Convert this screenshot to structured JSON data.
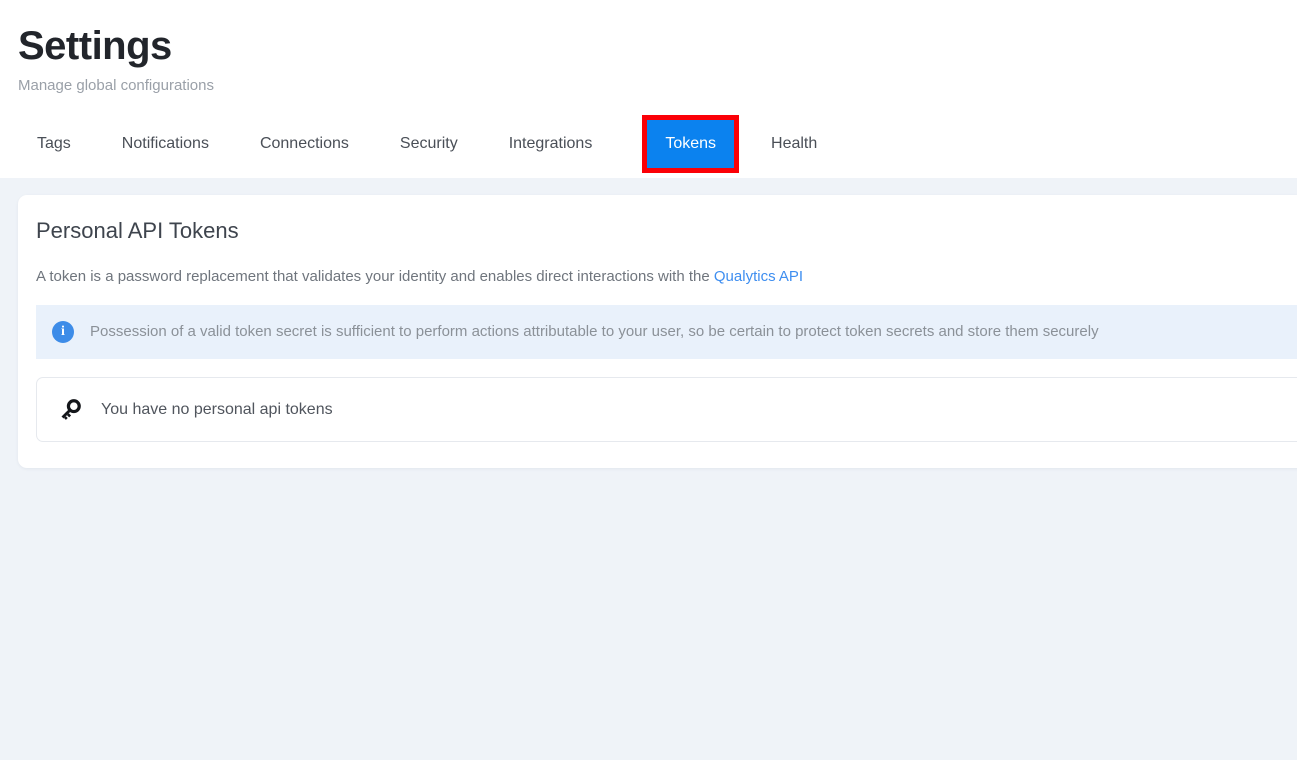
{
  "header": {
    "title": "Settings",
    "subtitle": "Manage global configurations"
  },
  "tabs": [
    {
      "label": "Tags",
      "active": false
    },
    {
      "label": "Notifications",
      "active": false
    },
    {
      "label": "Connections",
      "active": false
    },
    {
      "label": "Security",
      "active": false
    },
    {
      "label": "Integrations",
      "active": false
    },
    {
      "label": "Tokens",
      "active": true
    },
    {
      "label": "Health",
      "active": false
    }
  ],
  "card": {
    "title": "Personal API Tokens",
    "description_prefix": "A token is a password replacement that validates your identity and enables direct interactions with the ",
    "description_link": "Qualytics API",
    "info_icon": "info-circle-icon",
    "info_text": "Possession of a valid token secret is sufficient to perform actions attributable to your user, so be certain to protect token secrets and store them securely",
    "empty_icon": "key-icon",
    "empty_text": "You have no personal api tokens"
  },
  "colors": {
    "accent_blue": "#0b82ef",
    "highlight_red": "#fb0007",
    "link_blue": "#3e8ef0",
    "info_bg": "#e9f1fb",
    "info_icon_blue": "#3d8ce8",
    "page_bg": "#eff3f8"
  }
}
